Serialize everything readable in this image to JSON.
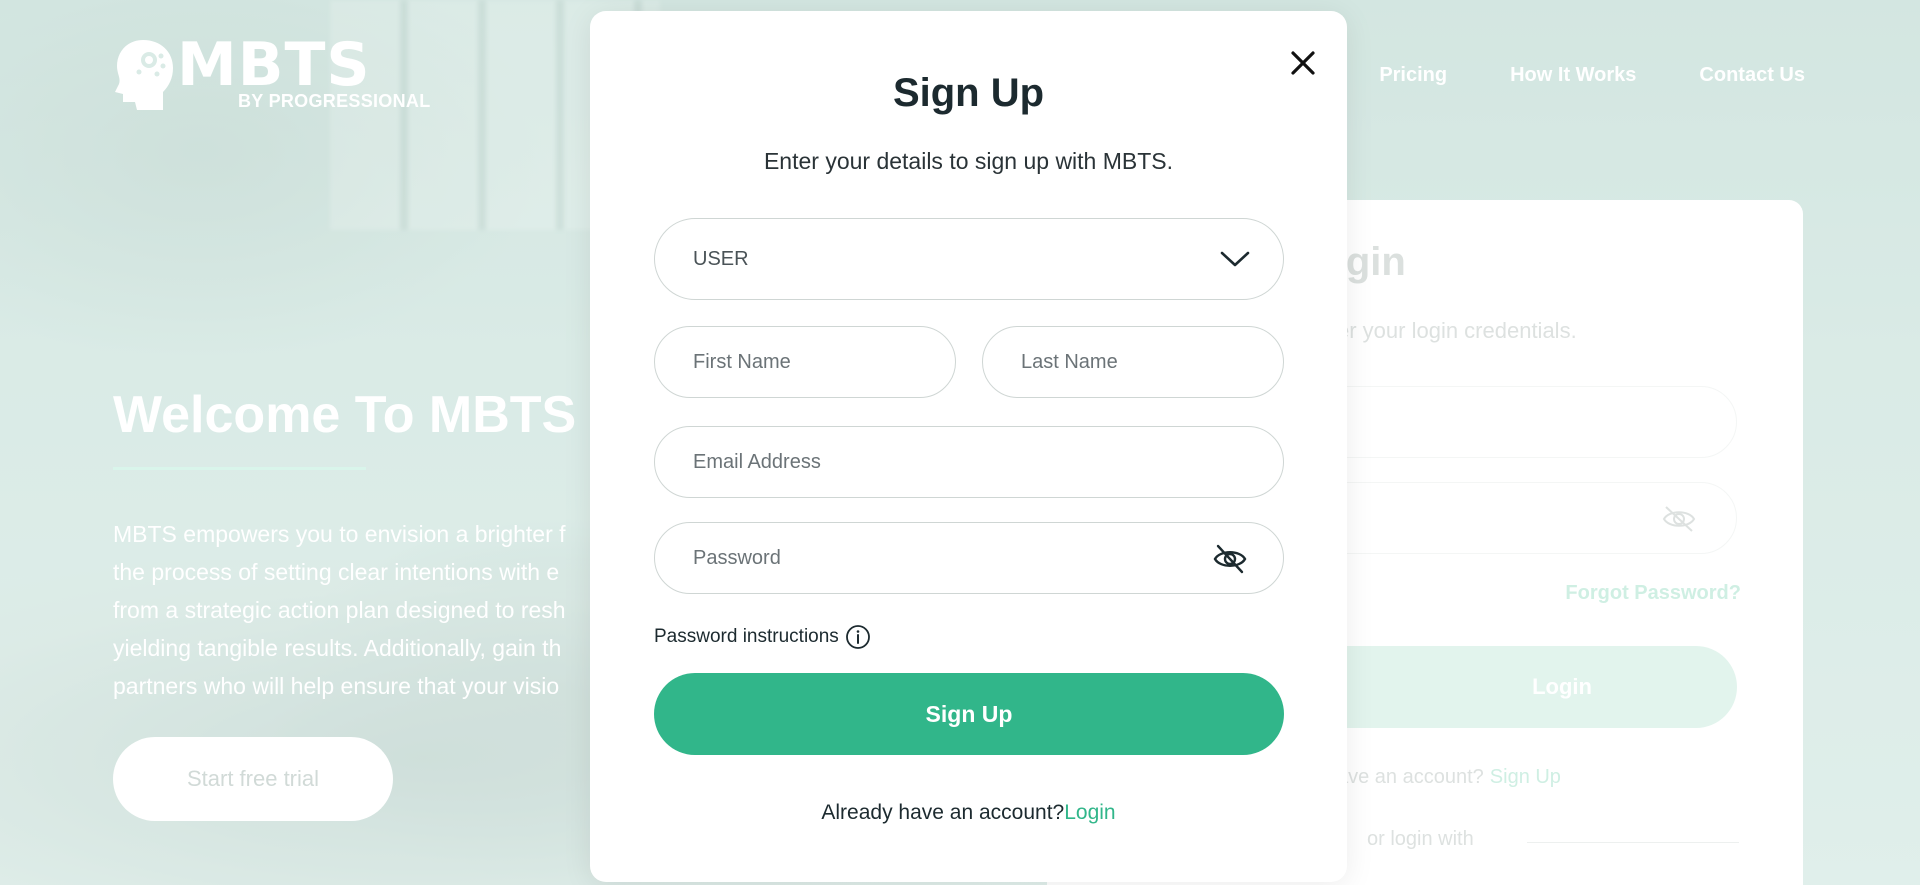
{
  "brand": {
    "logo_main": "MBTS",
    "logo_sub": "BY PROGRESSIONAL"
  },
  "nav": {
    "items": [
      "Pricing",
      "How It Works",
      "Contact Us"
    ]
  },
  "hero": {
    "title": "Welcome To MBTS",
    "lines": [
      "MBTS empowers you to envision a brighter f",
      "the process of setting clear intentions with e",
      "from a strategic action plan designed to resh",
      "yielding tangible results. Additionally, gain th",
      "partners who will help ensure that your visio"
    ],
    "cta_label": "Start free trial"
  },
  "login_card": {
    "title": "Login",
    "subtitle": "er your login credentials.",
    "forgot_label": "Forgot Password?",
    "login_label": "Login",
    "no_account_text": "ave an account?",
    "signup_link": "Sign Up",
    "or_login_with": "or login with"
  },
  "modal": {
    "title": "Sign Up",
    "subtitle": "Enter your details to sign up with MBTS.",
    "role": {
      "selected": "USER"
    },
    "first_name": {
      "placeholder": "First Name"
    },
    "last_name": {
      "placeholder": "Last Name"
    },
    "email": {
      "placeholder": "Email Address"
    },
    "password": {
      "placeholder": "Password"
    },
    "password_instructions": "Password instructions",
    "submit_label": "Sign Up",
    "footer_text": "Already have an account?",
    "footer_link": "Login"
  },
  "colors": {
    "accent": "#31b68a",
    "accent_faded": "#d3efe4",
    "text_dark": "#1c2a2f"
  },
  "icons": {
    "close": "close-icon",
    "chevron": "chevron-down-icon",
    "eye": "eye-off-icon",
    "info": "info-icon",
    "logo": "head-logo-icon"
  }
}
